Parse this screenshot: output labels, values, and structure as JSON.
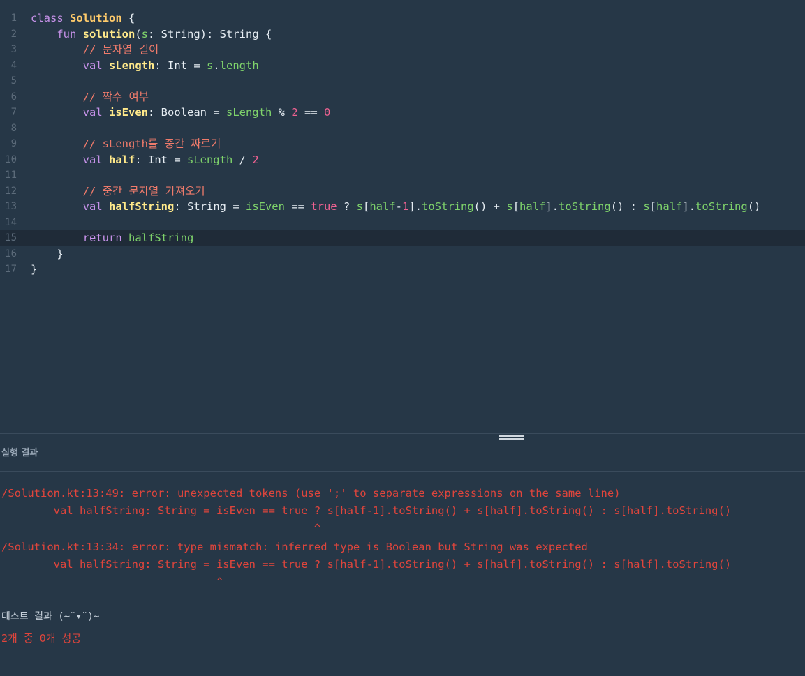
{
  "editor": {
    "line_numbers": [
      "1",
      "2",
      "3",
      "4",
      "5",
      "6",
      "7",
      "8",
      "9",
      "10",
      "11",
      "12",
      "13",
      "14",
      "15",
      "16",
      "17"
    ],
    "active_line": 15
  },
  "results": {
    "title": "실행 결과",
    "errors": [
      "/Solution.kt:13:49: error: unexpected tokens (use ';' to separate expressions on the same line)",
      "        val halfString: String = isEven == true ? s[half-1].toString() + s[half].toString() : s[half].toString()",
      "                                                ^",
      "/Solution.kt:13:34: error: type mismatch: inferred type is Boolean but String was expected",
      "        val halfString: String = isEven == true ? s[half-1].toString() + s[half].toString() : s[half].toString()",
      "                                 ^"
    ],
    "test_title": "테스트 결과 (~˘▾˘)~",
    "test_summary": "2개 중 0개 성공"
  }
}
